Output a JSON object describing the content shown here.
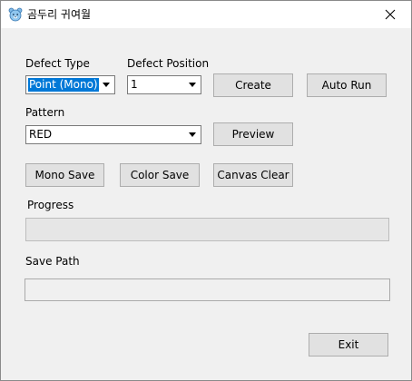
{
  "window": {
    "title": "곰두리 귀여월",
    "icon": "bear-icon",
    "close_icon": "close-icon"
  },
  "form": {
    "defect_type": {
      "label": "Defect Type",
      "value": "Point (Mono)"
    },
    "defect_position": {
      "label": "Defect Position",
      "value": "1"
    },
    "pattern": {
      "label": "Pattern",
      "value": "RED"
    },
    "progress": {
      "label": "Progress",
      "value_fraction": 0
    },
    "save_path": {
      "label": "Save Path",
      "value": ""
    }
  },
  "buttons": {
    "create": "Create",
    "auto_run": "Auto Run",
    "preview": "Preview",
    "mono_save": "Mono Save",
    "color_save": "Color Save",
    "canvas_clear": "Canvas Clear",
    "exit": "Exit"
  },
  "colors": {
    "selection": "#0078d7",
    "button_face": "#e1e1e1",
    "window_bg": "#f0f0f0"
  }
}
